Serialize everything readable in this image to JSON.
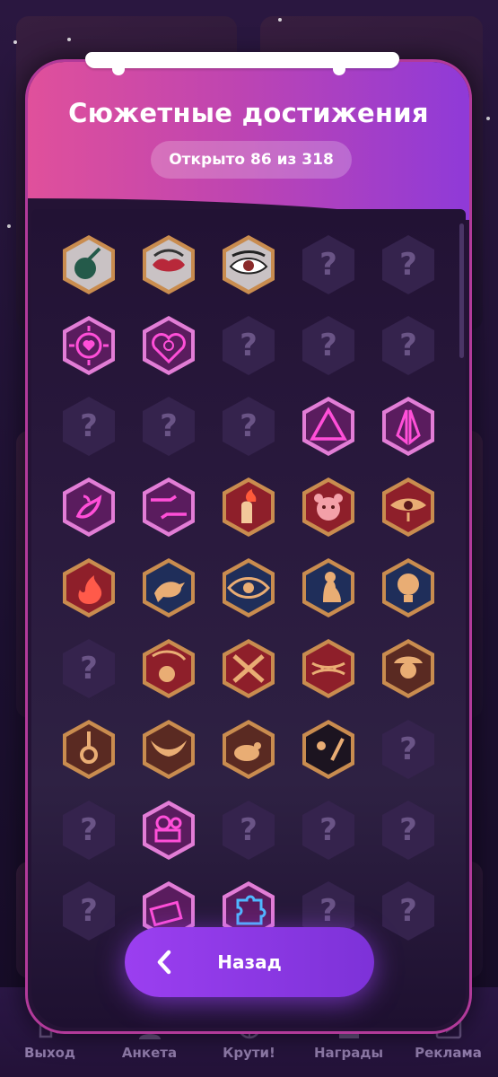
{
  "modal": {
    "title": "Сюжетные достижения",
    "counter": "Открыто 86 из 318",
    "back_label": "Назад"
  },
  "achievements": [
    {
      "icon": "fairy-tale-apple-icon",
      "unlocked": true
    },
    {
      "icon": "lips-icon",
      "unlocked": true
    },
    {
      "icon": "eye-icon",
      "unlocked": true
    },
    {
      "icon": "locked-icon",
      "unlocked": false
    },
    {
      "icon": "locked-icon",
      "unlocked": false
    },
    {
      "icon": "target-heart-icon",
      "unlocked": true
    },
    {
      "icon": "heart-gender-icon",
      "unlocked": true
    },
    {
      "icon": "locked-icon",
      "unlocked": false
    },
    {
      "icon": "locked-icon",
      "unlocked": false
    },
    {
      "icon": "locked-icon",
      "unlocked": false
    },
    {
      "icon": "locked-icon",
      "unlocked": false
    },
    {
      "icon": "locked-icon",
      "unlocked": false
    },
    {
      "icon": "locked-icon",
      "unlocked": false
    },
    {
      "icon": "triangle-icon",
      "unlocked": true
    },
    {
      "icon": "praying-hands-icon",
      "unlocked": true
    },
    {
      "icon": "pepper-icon",
      "unlocked": true
    },
    {
      "icon": "touching-hands-icon",
      "unlocked": true
    },
    {
      "icon": "flame-arm-icon",
      "unlocked": true
    },
    {
      "icon": "bear-icon",
      "unlocked": true
    },
    {
      "icon": "crying-eye-icon",
      "unlocked": true
    },
    {
      "icon": "fire-icon",
      "unlocked": true
    },
    {
      "icon": "raven-icon",
      "unlocked": true
    },
    {
      "icon": "watching-eye-icon",
      "unlocked": true
    },
    {
      "icon": "woman-silhouette-icon",
      "unlocked": true
    },
    {
      "icon": "lightbulb-icon",
      "unlocked": true
    },
    {
      "icon": "locked-icon",
      "unlocked": false
    },
    {
      "icon": "skull-scythe-icon",
      "unlocked": true
    },
    {
      "icon": "crossed-pistols-icon",
      "unlocked": true
    },
    {
      "icon": "fangs-icon",
      "unlocked": true
    },
    {
      "icon": "woman-hat-icon",
      "unlocked": true
    },
    {
      "icon": "noose-icon",
      "unlocked": true
    },
    {
      "icon": "dove-icon",
      "unlocked": true
    },
    {
      "icon": "rat-icon",
      "unlocked": true
    },
    {
      "icon": "paw-feather-icon",
      "unlocked": true
    },
    {
      "icon": "locked-icon",
      "unlocked": false
    },
    {
      "icon": "locked-icon",
      "unlocked": false
    },
    {
      "icon": "film-camera-icon",
      "unlocked": true
    },
    {
      "icon": "locked-icon",
      "unlocked": false
    },
    {
      "icon": "locked-icon",
      "unlocked": false
    },
    {
      "icon": "locked-icon",
      "unlocked": false
    },
    {
      "icon": "locked-icon",
      "unlocked": false
    },
    {
      "icon": "money-stack-icon",
      "unlocked": true
    },
    {
      "icon": "puzzle-icon",
      "unlocked": true
    },
    {
      "icon": "locked-icon",
      "unlocked": false
    },
    {
      "icon": "locked-icon",
      "unlocked": false
    }
  ],
  "bottom_nav": {
    "items": [
      {
        "label": "Выход",
        "icon": "exit-icon"
      },
      {
        "label": "Анкета",
        "icon": "profile-icon"
      },
      {
        "label": "Крути!",
        "icon": "wheel-icon"
      },
      {
        "label": "Награды",
        "icon": "rewards-icon"
      },
      {
        "label": "Реклама",
        "icon": "ad-video-icon"
      }
    ]
  },
  "colors": {
    "header_start": "#e0509b",
    "header_end": "#8f3ad8",
    "button": "#9b3ff0",
    "locked_hex": "#35234d",
    "neon_pink": "#ff4fd8",
    "dark_red": "#8e1f2a",
    "navy": "#1f2e5a",
    "bronze": "#c98c4f"
  }
}
